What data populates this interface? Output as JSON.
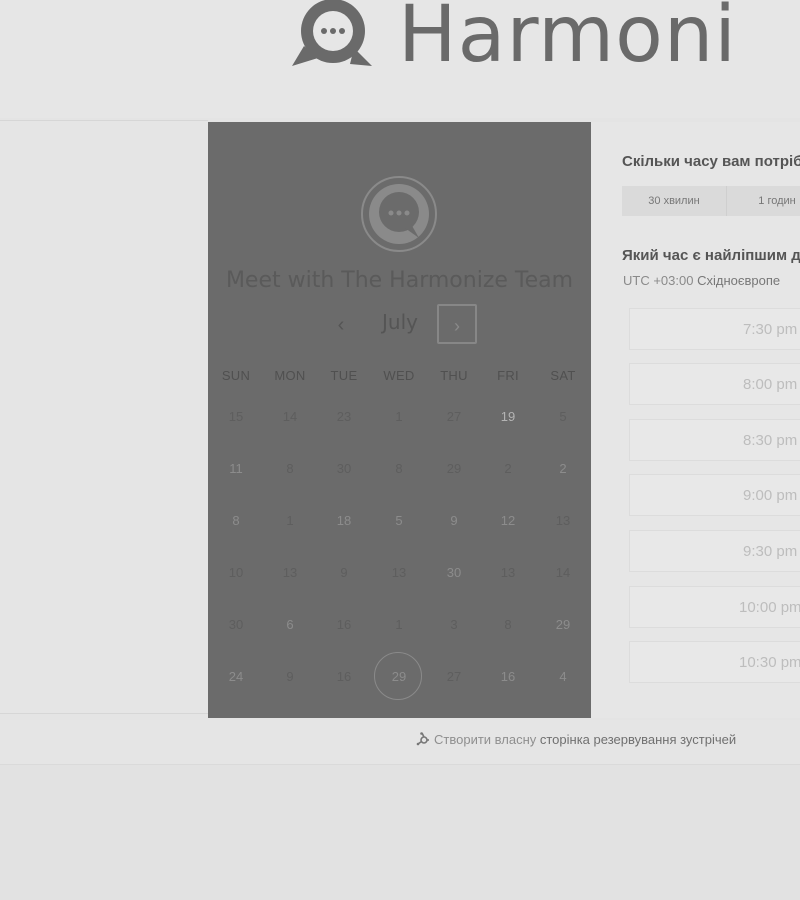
{
  "brand": {
    "name": "Harmoni",
    "logo_icon": "speech-bubble-icon"
  },
  "calendar": {
    "title": "Meet with The Harmonize Team",
    "month": "July",
    "prev_label": "‹",
    "next_label": "›",
    "weekdays": [
      "SUN",
      "MON",
      "TUE",
      "WED",
      "THU",
      "FRI",
      "SAT"
    ],
    "weeks": [
      [
        "15",
        "14",
        "23",
        "1",
        "27",
        "19",
        "5"
      ],
      [
        "11",
        "8",
        "30",
        "8",
        "29",
        "2",
        "2"
      ],
      [
        "8",
        "1",
        "18",
        "5",
        "9",
        "12",
        "13"
      ],
      [
        "10",
        "13",
        "9",
        "13",
        "30",
        "13",
        "14"
      ],
      [
        "30",
        "6",
        "16",
        "1",
        "3",
        "8",
        "29"
      ],
      [
        "24",
        "9",
        "16",
        "29",
        "27",
        "16",
        "4"
      ]
    ],
    "selected_day": "29"
  },
  "booking": {
    "duration_question": "Скільки часу вам потріб",
    "durations": [
      "30 хвилин",
      "1 годин"
    ],
    "time_question": "Який час є найліпшим д",
    "timezone_prefix": "UTC +03:00 ",
    "timezone_name": "Східноєвропе",
    "slots": [
      "7:30 pm",
      "8:00 pm",
      "8:30 pm",
      "9:00 pm",
      "9:30 pm",
      "10:00 pm",
      "10:30 pm"
    ]
  },
  "footer": {
    "icon": "sprocket-icon",
    "link_plain": "Створити власну ",
    "link_strong": "сторінка резервування зустрічей"
  }
}
